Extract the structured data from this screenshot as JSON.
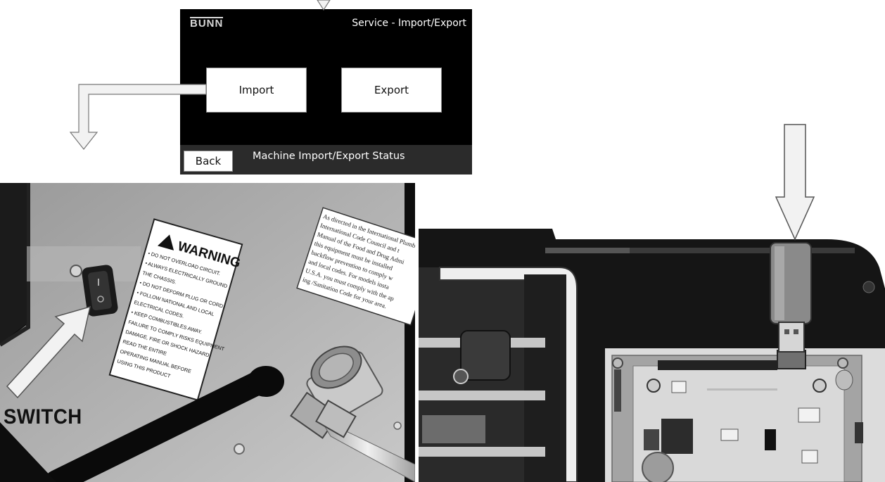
{
  "screen": {
    "brand": "BUNN",
    "title": "Service - Import/Export",
    "import_label": "Import",
    "export_label": "Export",
    "back_label": "Back",
    "status_text": "Machine Import/Export Status"
  },
  "photo_left": {
    "switch_label": "SWITCH",
    "warning_title": "WARNING",
    "warning_lines": [
      "• DO NOT OVERLOAD CIRCUIT.",
      "• ALWAYS ELECTRICALLY GROUND",
      "  THE CHASSIS.",
      "• DO NOT DEFORM PLUG OR CORD.",
      "• FOLLOW NATIONAL AND LOCAL",
      "  ELECTRICAL CODES.",
      "• KEEP COMBUSTIBLES AWAY.",
      "FAILURE TO COMPLY RISKS EQUIPMENT",
      "DAMAGE, FIRE OR SHOCK HAZARD.",
      "READ THE ENTIRE",
      "OPERATING MANUAL BEFORE",
      "USING THIS PRODUCT"
    ],
    "notice_lines": [
      "As directed in the International Plumb",
      "International Code Council and t",
      "Manual of the Food and Drug Admi",
      "this equipment must be installed",
      "backflow prevention to comply w",
      "and local codes. For models insta",
      "U.S.A. you must comply with the ap",
      "ing /Sanitation Code for your area."
    ]
  },
  "colors": {
    "screen_bg": "#000000",
    "status_bar": "#2b2b2b",
    "arrow_fill": "#e6e6e6",
    "arrow_stroke": "#666666"
  }
}
